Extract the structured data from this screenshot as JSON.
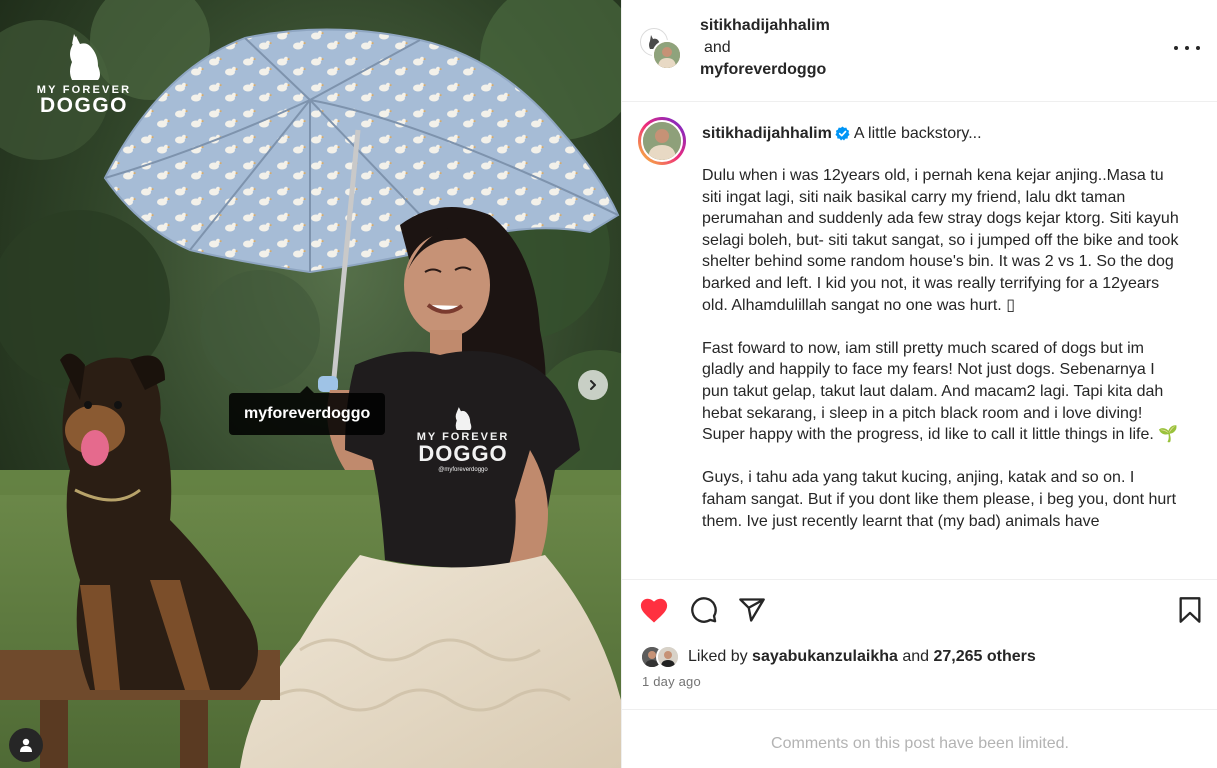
{
  "photo": {
    "brand_top": "MY FOREVER",
    "brand_bottom": "DOGGO",
    "shirt_top": "MY FOREVER",
    "shirt_bottom": "DOGGO",
    "shirt_handle": "@myforeverdoggo",
    "tag_label": "myforeverdoggo",
    "next_icon": "chevron-right-icon",
    "tagged_icon": "user-tag-icon"
  },
  "header": {
    "user1": "sitikhadijahhalim",
    "and_text": "and",
    "user2": "myforeverdoggo",
    "more_icon": "more-horizontal-icon"
  },
  "caption": {
    "username": "sitikhadijahhalim",
    "verified_color": "#0095f6",
    "title": "A little backstory...",
    "paragraphs": [
      "Dulu when i was 12years old, i pernah kena kejar anjing..Masa tu siti ingat lagi, siti naik basikal carry my friend, lalu dkt taman perumahan and suddenly ada few stray dogs kejar ktorg. Siti kayuh selagi boleh, but- siti takut sangat, so i jumped off the bike and took shelter behind some random house's bin. It was 2 vs 1. So the dog barked and left. I kid you not, it was really terrifying for a 12years old. Alhamdulillah sangat no one was hurt. ▯",
      "Fast foward to now, iam still pretty much scared of dogs but im gladly and happily to face my fears! Not just dogs. Sebenarnya I pun takut gelap, takut laut dalam. And macam2 lagi. Tapi kita dah hebat sekarang, i sleep in a pitch black room and i love diving! Super happy with the progress, id like to call it little things in life. 🌱",
      "Guys, i tahu ada yang takut kucing, anjing, katak and so on. I faham sangat. But if you dont like them please, i beg you, dont hurt them. Ive just recently learnt that (my bad) animals have"
    ]
  },
  "actions": {
    "like_icon": "heart-filled-icon",
    "like_color": "#ff3040",
    "comment_icon": "comment-icon",
    "share_icon": "send-icon",
    "save_icon": "bookmark-icon",
    "liked_by_prefix": "Liked by",
    "liked_by_user": "sayabukanzulaikha",
    "and_text": "and",
    "others_count": "27,265 others",
    "timestamp": "1 day ago"
  },
  "comments": {
    "limited_notice": "Comments on this post have been limited."
  }
}
